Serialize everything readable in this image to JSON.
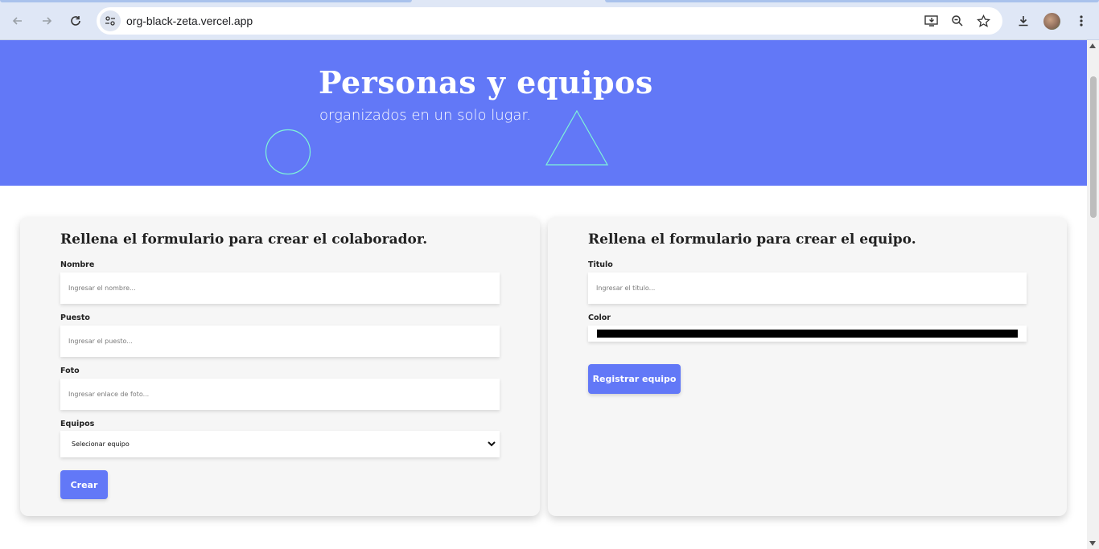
{
  "browser": {
    "url": "org-black-zeta.vercel.app",
    "icons": [
      "back-icon",
      "forward-icon",
      "reload-icon",
      "site-info-icon",
      "install-app-icon",
      "zoom-icon",
      "bookmark-star-icon",
      "download-icon",
      "profile-avatar",
      "more-menu-icon"
    ]
  },
  "hero": {
    "title": "Personas y equipos",
    "subtitle": "organizados en un solo lugar."
  },
  "collaborator_form": {
    "title": "Rellena el formulario para crear el colaborador.",
    "fields": [
      {
        "label": "Nombre",
        "placeholder": "Ingresar el nombre..."
      },
      {
        "label": "Puesto",
        "placeholder": "Ingresar el puesto..."
      },
      {
        "label": "Foto",
        "placeholder": "Ingresar enlace de foto..."
      }
    ],
    "team_select": {
      "label": "Equipos",
      "value": "Selecionar equipo"
    },
    "submit_label": "Crear"
  },
  "team_form": {
    "title": "Rellena el formulario para crear el equipo.",
    "title_field": {
      "label": "Titulo",
      "placeholder": "Ingresar el titulo..."
    },
    "color_field": {
      "label": "Color",
      "value": "#000000"
    },
    "submit_label": "Registrar equipo"
  },
  "colors": {
    "brand": "#6278f7",
    "card_background": "#f6f6f6",
    "hero_shapes": "#7ff5d8"
  }
}
